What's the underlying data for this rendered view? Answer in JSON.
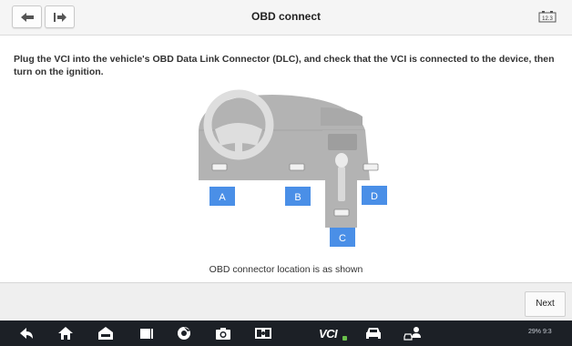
{
  "header": {
    "title": "OBD connect",
    "back_icon": "back-arrow-icon",
    "exit_icon": "exit-icon",
    "battery_voltage": "12.3"
  },
  "instruction": "Plug the VCI into the vehicle's OBD Data Link Connector (DLC), and check that the VCI is connected to the device, then turn on the ignition.",
  "diagram": {
    "labels": [
      "A",
      "B",
      "C",
      "D"
    ],
    "label_color": "#4a8fe7",
    "dashboard_color": "#b3b3b3"
  },
  "caption": "OBD connector location is as shown",
  "footer": {
    "next_label": "Next"
  },
  "system_bar": {
    "icons": [
      "back-icon",
      "home-icon",
      "car-home-icon",
      "recent-apps-icon",
      "browser-icon",
      "camera-icon",
      "screen-record-icon",
      "vci-icon",
      "car-icon",
      "user-vehicle-icon"
    ],
    "vci_text": "VCI",
    "status_text": "29% 9:3"
  },
  "colors": {
    "accent": "#4a8fe7",
    "system_bar_bg": "#1c2026",
    "vci_green": "#6ac04b"
  }
}
